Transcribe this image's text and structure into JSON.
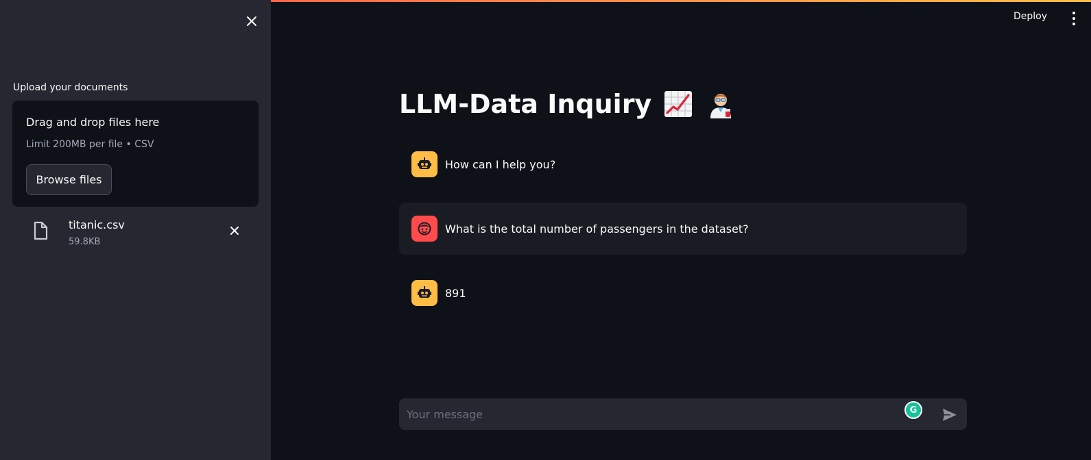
{
  "sidebar": {
    "upload_label": "Upload your documents",
    "dropzone": {
      "title": "Drag and drop files here",
      "limit": "Limit 200MB per file • CSV",
      "browse_label": "Browse files"
    },
    "files": [
      {
        "name": "titanic.csv",
        "size": "59.8KB"
      }
    ]
  },
  "header": {
    "deploy_label": "Deploy"
  },
  "main": {
    "title": "LLM-Data Inquiry",
    "title_icons": [
      "chart-increasing-icon",
      "scientist-icon"
    ],
    "messages": [
      {
        "role": "assistant",
        "text": "How can I help you?"
      },
      {
        "role": "user",
        "text": "What is the total number of passengers in the dataset?"
      },
      {
        "role": "assistant",
        "text": "891"
      }
    ],
    "chat_input": {
      "placeholder": "Your message",
      "value": ""
    }
  },
  "colors": {
    "background": "#0e1117",
    "sidebar": "#262730",
    "accent_red": "#ff4b4b",
    "accent_yellow": "#ffbd45",
    "text": "#fafafa",
    "muted_text": "#a3a8b8"
  }
}
